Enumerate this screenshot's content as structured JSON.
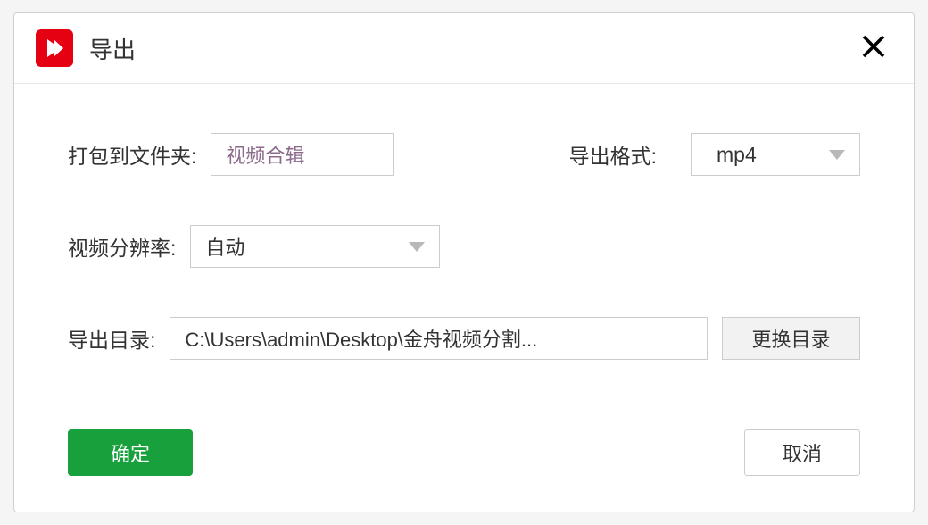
{
  "dialog": {
    "title": "导出"
  },
  "form": {
    "folder_label": "打包到文件夹:",
    "folder_value": "视频合辑",
    "format_label": "导出格式:",
    "format_value": "mp4",
    "resolution_label": "视频分辨率:",
    "resolution_value": "自动",
    "path_label": "导出目录:",
    "path_value": "C:\\Users\\admin\\Desktop\\金舟视频分割...",
    "change_dir_label": "更换目录"
  },
  "buttons": {
    "ok": "确定",
    "cancel": "取消"
  }
}
